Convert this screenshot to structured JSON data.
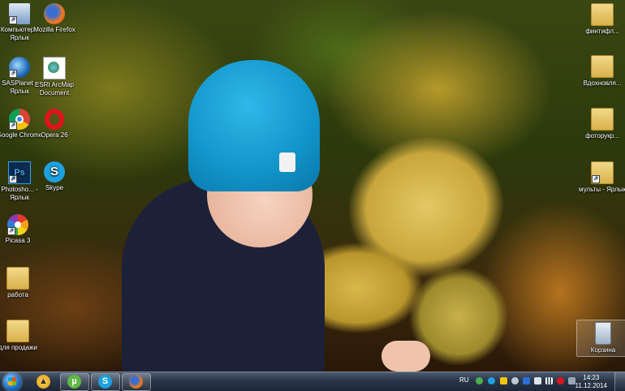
{
  "desktop": {
    "left_icons": [
      {
        "label": "Компьютер - Ярлык",
        "icon": "computer-icon"
      },
      {
        "label": "Mozilla Firefox",
        "icon": "firefox-icon"
      },
      {
        "label": "SASPlanet - Ярлык",
        "icon": "sasplanet-icon"
      },
      {
        "label": "ESRI ArcMap Document",
        "icon": "arcmap-icon"
      },
      {
        "label": "Google Chrome",
        "icon": "chrome-icon"
      },
      {
        "label": "Opera 26",
        "icon": "opera-icon"
      },
      {
        "label": "Photosho... - Ярлык",
        "icon": "photoshop-icon"
      },
      {
        "label": "Skype",
        "icon": "skype-icon"
      },
      {
        "label": "Picasa 3",
        "icon": "picasa-icon"
      },
      {
        "label": "работа",
        "icon": "folder-icon"
      },
      {
        "label": "для продажи",
        "icon": "folder-icon"
      }
    ],
    "right_icons": [
      {
        "label": "финтифл...",
        "icon": "folder-icon"
      },
      {
        "label": "Вдохновля...",
        "icon": "folder-icon"
      },
      {
        "label": "фоторукр...",
        "icon": "folder-icon"
      },
      {
        "label": "мульты - Ярлык",
        "icon": "folder-shortcut-icon"
      },
      {
        "label": "Корзина",
        "icon": "recycle-bin-icon"
      }
    ]
  },
  "taskbar": {
    "pinned": [
      {
        "name": "aimp",
        "icon": "aimp-icon",
        "color": "#f2b01e"
      },
      {
        "name": "utorrent",
        "icon": "utorrent-icon",
        "color": "#5fb844"
      },
      {
        "name": "skype",
        "icon": "skype-icon",
        "color": "#1da1e0"
      },
      {
        "name": "firefox",
        "icon": "firefox-icon",
        "color": "#e8742a"
      }
    ],
    "language": "RU",
    "time": "14:23",
    "date": "11.12.2014"
  }
}
